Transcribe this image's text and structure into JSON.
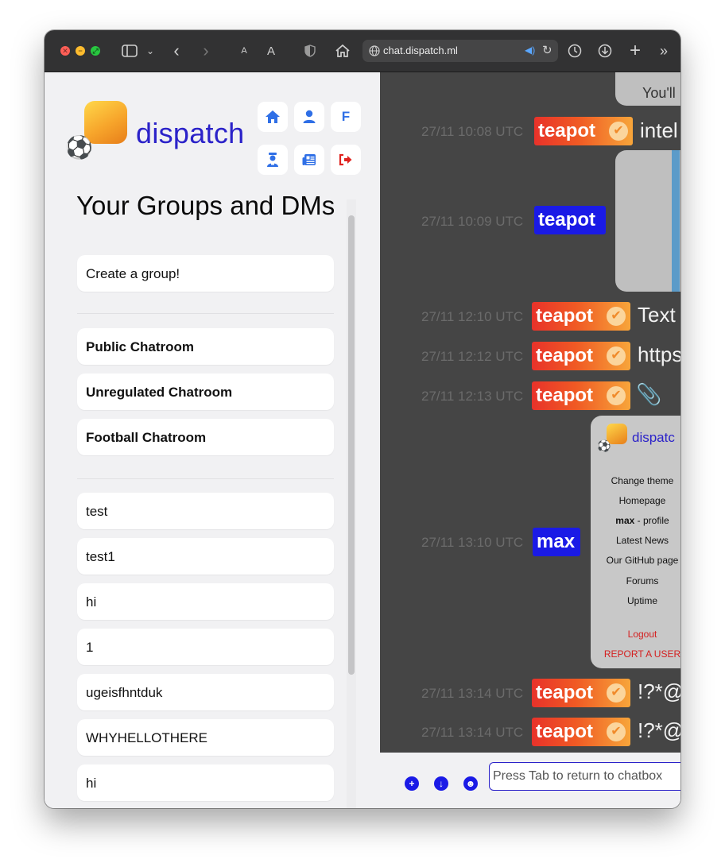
{
  "browser": {
    "url": "chat.dispatch.ml",
    "reader_small": "A",
    "reader_large": "A"
  },
  "app": {
    "logo_text": "dispatch",
    "nav": {
      "home_icon": "home-icon",
      "profile_icon": "user-icon",
      "theme_label": "F",
      "admin_icon": "admin-icon",
      "news_icon": "newspaper-icon",
      "logout_icon": "logout-icon"
    }
  },
  "sidebar": {
    "heading": "Your Groups and DMs",
    "create_group": "Create a group!",
    "chatrooms": [
      "Public Chatroom",
      "Unregulated Chatroom",
      "Football Chatroom"
    ],
    "groups": [
      "test",
      "test1",
      "hi",
      "1",
      "ugeisfhntduk",
      "WHYHELLOTHERE",
      "hi"
    ]
  },
  "chat": {
    "top_bubble_text": "You'll",
    "messages": [
      {
        "time": "27/11 10:08 UTC",
        "user": "teapot",
        "verified": true,
        "text": "intel"
      },
      {
        "time": "27/11 10:09 UTC",
        "user": "teapot",
        "verified": false,
        "text": ""
      },
      {
        "time": "27/11 12:10 UTC",
        "user": "teapot",
        "verified": true,
        "text": "Text"
      },
      {
        "time": "27/11 12:12 UTC",
        "user": "teapot",
        "verified": true,
        "text": "https"
      },
      {
        "time": "27/11 12:13 UTC",
        "user": "teapot",
        "verified": true,
        "text": "📎"
      },
      {
        "time": "27/11 13:10 UTC",
        "user": "max",
        "verified": false,
        "text": ""
      },
      {
        "time": "27/11 13:14 UTC",
        "user": "teapot",
        "verified": true,
        "text": "!?*@"
      },
      {
        "time": "27/11 13:14 UTC",
        "user": "teapot",
        "verified": true,
        "text": "!?*@"
      }
    ],
    "embed": {
      "title": "dispatc",
      "links": [
        "Change theme",
        "Homepage",
        "profile",
        "Latest News",
        "Our GitHub page",
        "Forums",
        "Uptime"
      ],
      "profile_user": "max",
      "profile_sep": " - ",
      "logout": "Logout",
      "report": "REPORT A USER"
    },
    "composer": {
      "placeholder": "Press Tab to return to chatbox"
    }
  },
  "colors": {
    "brand_blue": "#2b22c9",
    "verified_gradient_start": "#e8322a",
    "verified_gradient_end": "#f7a53a",
    "name_blue": "#1a1ae6",
    "logout_red": "#d42020",
    "nav_blue": "#2f6fe6"
  }
}
